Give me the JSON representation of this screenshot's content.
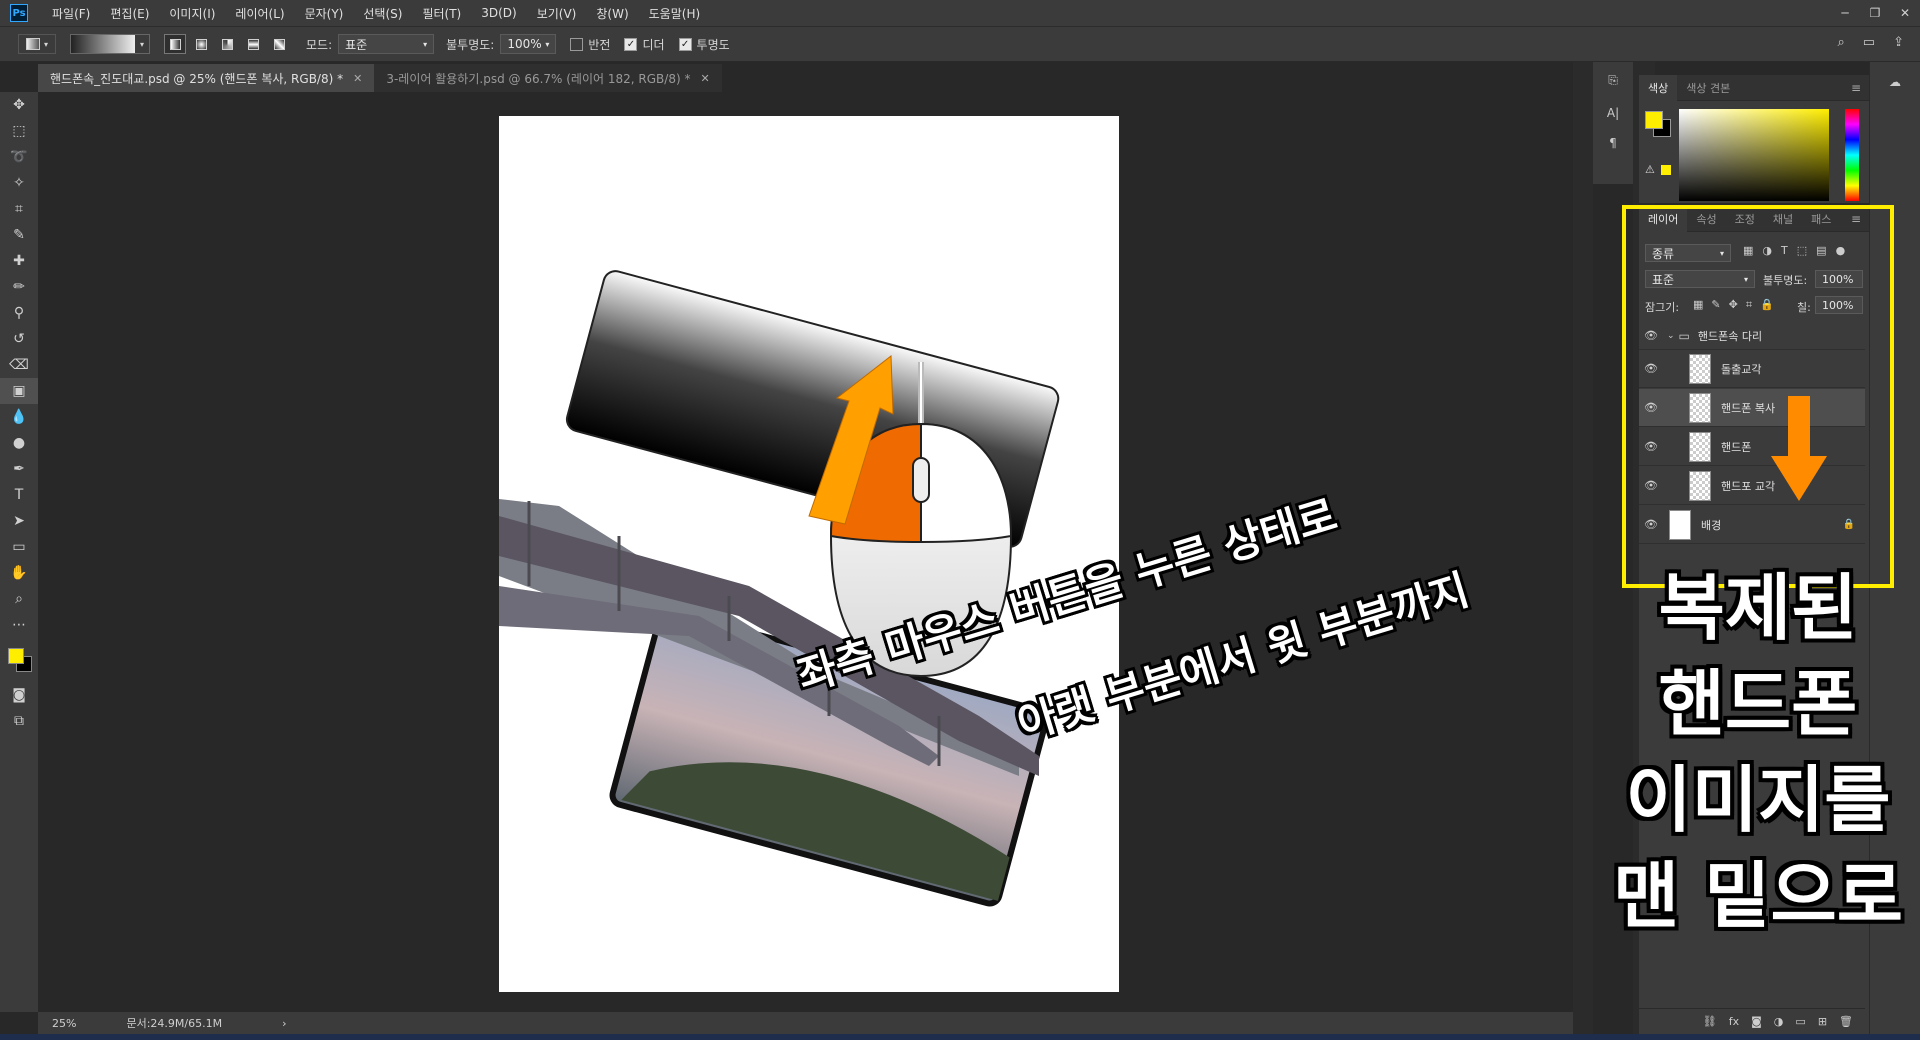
{
  "app": {
    "logo": "Ps"
  },
  "menu": [
    "파일(F)",
    "편집(E)",
    "이미지(I)",
    "레이어(L)",
    "문자(Y)",
    "선택(S)",
    "필터(T)",
    "3D(D)",
    "보기(V)",
    "창(W)",
    "도움말(H)"
  ],
  "options": {
    "mode_label": "모드:",
    "mode_value": "표준",
    "opacity_label": "불투명도:",
    "opacity_value": "100%",
    "reverse_label": "반전",
    "dither_label": "디더",
    "transparency_label": "투명도",
    "reverse_checked": false,
    "dither_checked": true,
    "transparency_checked": true
  },
  "tabs": [
    {
      "label": "핸드폰속_진도대교.psd @ 25% (핸드폰 복사, RGB/8) *",
      "active": true
    },
    {
      "label": "3-레이어 활용하기.psd @ 66.7% (레이어 182, RGB/8) *",
      "active": false
    }
  ],
  "status": {
    "zoom": "25%",
    "doc": "문서:24.9M/65.1M"
  },
  "color_panel": {
    "tab1": "색상",
    "tab2": "색상 견본",
    "fg_color": "#ffee00"
  },
  "layers_panel": {
    "tabs": [
      "레이어",
      "속성",
      "조정",
      "채널",
      "패스"
    ],
    "filter_label": "종류",
    "blend_mode": "표준",
    "opacity_label": "불투명도:",
    "opacity_value": "100%",
    "lock_label": "잠그기:",
    "fill_label": "칠:",
    "fill_value": "100%",
    "group_name": "핸드폰속 다리",
    "layers": [
      {
        "name": "돌출교각",
        "selected": false
      },
      {
        "name": "핸드폰 복사",
        "selected": true
      },
      {
        "name": "핸드폰",
        "selected": false
      },
      {
        "name": "핸드포 교각",
        "selected": false
      }
    ],
    "background_layer": "배경"
  },
  "annotations": {
    "side_lines": [
      "복제된",
      "핸드폰",
      "이미지를",
      "맨 밑으로"
    ],
    "instruction_line1": "좌측 마우스 버튼을 누른 상태로",
    "instruction_line2": "아랫 부분에서 윗 부분까지",
    "highlight_color": "#ffee00",
    "arrow_color": "#ff8c00"
  }
}
